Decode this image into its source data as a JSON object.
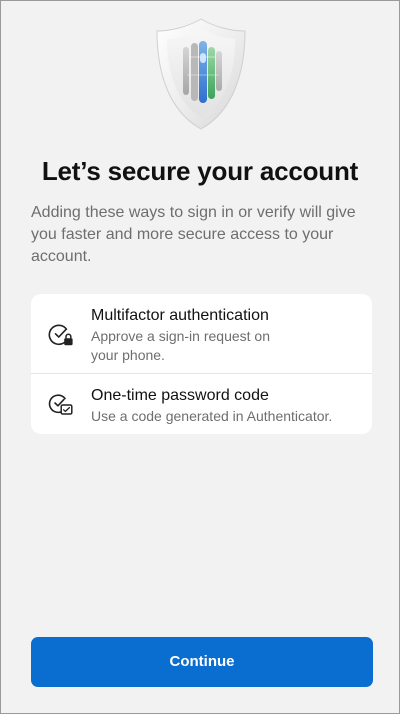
{
  "header": {
    "title": "Let’s secure your account",
    "subtitle": "Adding these ways to sign in or verify will give you faster and more secure access to your account."
  },
  "methods": [
    {
      "icon": "check-lock-icon",
      "title": "Multifactor authentication",
      "description_lines": [
        "Approve a sign-in request on",
        "your phone."
      ]
    },
    {
      "icon": "check-code-icon",
      "title": "One-time password code",
      "description_lines": [
        "Use a code generated in Authenticator."
      ]
    }
  ],
  "actions": {
    "continue_label": "Continue"
  },
  "colors": {
    "background": "#f2f2f2",
    "card": "#ffffff",
    "primary_button": "#0a6ed1",
    "title_text": "#111111",
    "secondary_text": "#6e6e6e"
  },
  "illustration": {
    "icon": "security-shield-icon"
  }
}
